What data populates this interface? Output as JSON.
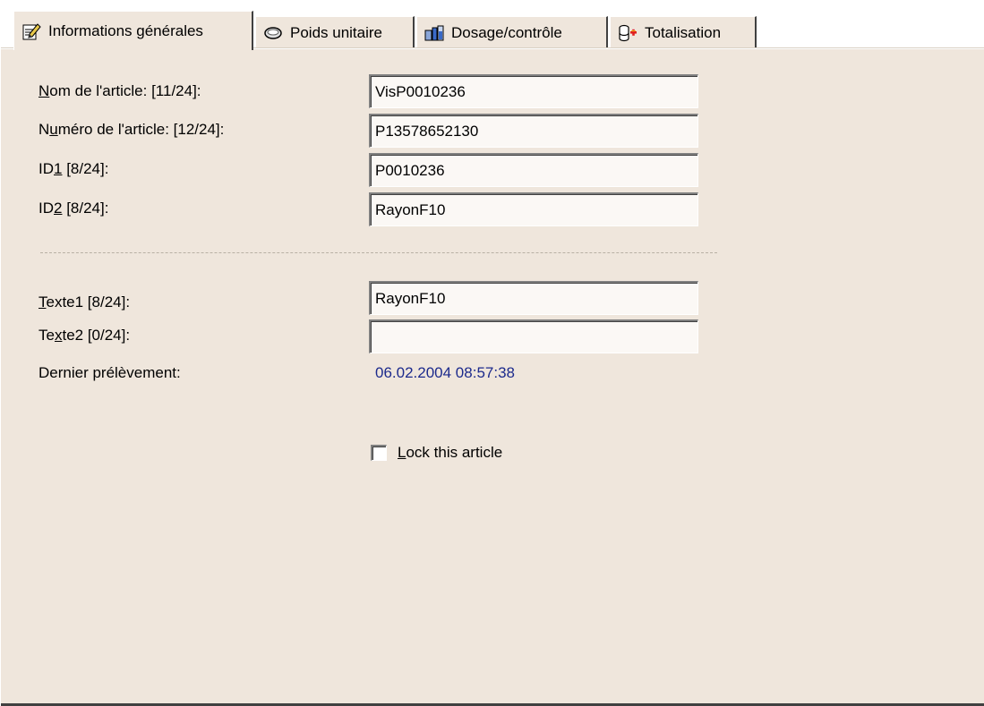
{
  "tabs": [
    {
      "label": "Informations générales",
      "icon": "notepad-edit-icon",
      "active": true
    },
    {
      "label": "Poids unitaire",
      "icon": "weight-icon",
      "active": false
    },
    {
      "label": "Dosage/contrôle",
      "icon": "dosage-icon",
      "active": false
    },
    {
      "label": "Totalisation",
      "icon": "totalisation-icon",
      "active": false
    }
  ],
  "form": {
    "nom_label_pre": "",
    "nom_label_ul": "N",
    "nom_label_post": "om de l'article: [11/24]:",
    "nom_value": "VisP0010236",
    "numero_label_pre": "N",
    "numero_label_ul": "u",
    "numero_label_post": "méro de l'article: [12/24]:",
    "numero_value": "P13578652130",
    "id1_label_pre": "ID",
    "id1_label_ul": "1",
    "id1_label_post": " [8/24]:",
    "id1_value": "P0010236",
    "id2_label_pre": "ID",
    "id2_label_ul": "2",
    "id2_label_post": " [8/24]:",
    "id2_value": "RayonF10",
    "texte1_label_pre": "",
    "texte1_label_ul": "T",
    "texte1_label_post": "exte1 [8/24]:",
    "texte1_value": "RayonF10",
    "texte2_label_pre": "Te",
    "texte2_label_ul": "x",
    "texte2_label_post": "te2 [0/24]:",
    "texte2_value": "",
    "dernier_label": "Dernier prélèvement:",
    "dernier_value": "06.02.2004 08:57:38",
    "lock_label_ul": "L",
    "lock_label_post": "ock this article",
    "lock_checked": false
  },
  "colors": {
    "background": "#efe6dc",
    "date_text": "#1c2a8c"
  }
}
